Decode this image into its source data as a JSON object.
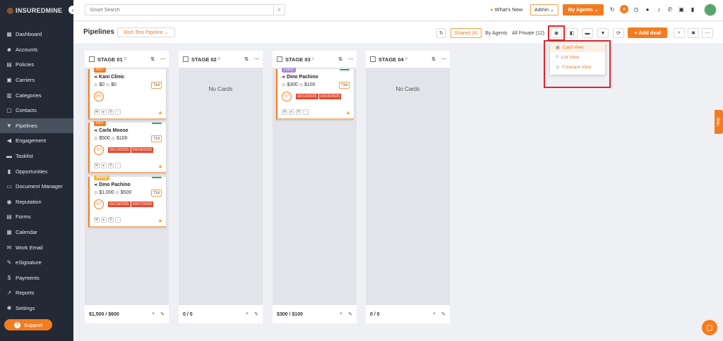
{
  "brand": {
    "name": "INSUREDMINE",
    "accent": "#f47c20"
  },
  "sidebar": {
    "items": [
      {
        "label": "Dashboard",
        "icon": "dashboard-icon",
        "glyph": "▦"
      },
      {
        "label": "Accounts",
        "icon": "accounts-icon",
        "glyph": "☻"
      },
      {
        "label": "Policies",
        "icon": "policies-icon",
        "glyph": "▤"
      },
      {
        "label": "Carriers",
        "icon": "carriers-icon",
        "glyph": "▣"
      },
      {
        "label": "Categories",
        "icon": "categories-icon",
        "glyph": "▥"
      },
      {
        "label": "Contacts",
        "icon": "contacts-icon",
        "glyph": "▢"
      },
      {
        "label": "Pipelines",
        "icon": "pipelines-icon",
        "glyph": "▼"
      },
      {
        "label": "Engagement",
        "icon": "engagement-icon",
        "glyph": "◀"
      },
      {
        "label": "Tasklist",
        "icon": "tasklist-icon",
        "glyph": "▬"
      },
      {
        "label": "Opportunities",
        "icon": "opportunities-icon",
        "glyph": "▮"
      },
      {
        "label": "Document Manager",
        "icon": "folder-icon",
        "glyph": "▭"
      },
      {
        "label": "Reputation",
        "icon": "reputation-icon",
        "glyph": "◉"
      },
      {
        "label": "Forms",
        "icon": "forms-icon",
        "glyph": "▤"
      },
      {
        "label": "Calendar",
        "icon": "calendar-icon",
        "glyph": "▦"
      },
      {
        "label": "Work Email",
        "icon": "email-icon",
        "glyph": "✉"
      },
      {
        "label": "eSignature",
        "icon": "esignature-icon",
        "glyph": "✎"
      },
      {
        "label": "Payments",
        "icon": "payments-icon",
        "glyph": "$"
      },
      {
        "label": "Reports",
        "icon": "reports-icon",
        "glyph": "↗"
      },
      {
        "label": "Settings",
        "icon": "gear-icon",
        "glyph": "✱"
      }
    ],
    "active_index": 6,
    "support_label": "Support"
  },
  "topbar": {
    "search_placeholder": "Smart Search",
    "whats_new": "What's New",
    "role_select": "Admin",
    "my_agents": "My Agents"
  },
  "subheader": {
    "title": "Pipelines",
    "pipeline_select": "Rish Test Pipeline",
    "shared": "Shared (4)",
    "by_agents": "By Agents",
    "all_private": "All Private (12)",
    "add_deal": "+ Add deal"
  },
  "view_menu": {
    "items": [
      "Card View",
      "List View",
      "Forecast View"
    ],
    "selected": "Card View"
  },
  "stages": [
    {
      "title": "STAGE 01",
      "count": "3",
      "footer": "$1,500 / $600",
      "cards": [
        {
          "tag": "HOT",
          "tag_color": "#f47c20",
          "name": "Kani Clinic",
          "amount1": "$0",
          "amount2": "$0",
          "days": "71d",
          "score": "0%",
          "dates": [],
          "green": false
        },
        {
          "tag": "HOT",
          "tag_color": "#f47c20",
          "name": "Carla Moose",
          "amount1": "$500",
          "amount2": "$100",
          "days": "71d",
          "score": "57",
          "dates": [
            "03/13/2025",
            "03/18/2025"
          ],
          "green": true
        },
        {
          "tag": "WARM",
          "tag_color": "#f5b34a",
          "name": "Dino Pachino",
          "amount1": "$1,000",
          "amount2": "$500",
          "days": "71d",
          "score": "57",
          "dates": [
            "03/13/2025",
            "03/27/2025"
          ],
          "green": true
        }
      ]
    },
    {
      "title": "STAGE 02",
      "count": "0",
      "footer": "0 / 0",
      "empty_text": "No Cards",
      "cards": []
    },
    {
      "title": "STAGE 03",
      "count": "1",
      "footer": "$300 / $100",
      "cards": [
        {
          "tag": "COLD",
          "tag_color": "#a98bd9",
          "name": "Dino Pachino",
          "amount1": "$300",
          "amount2": "$100",
          "days": "71d",
          "score": "57",
          "dates": [
            "03/13/2025",
            "03/18/2025"
          ],
          "green": true
        }
      ]
    },
    {
      "title": "STAGE 04",
      "count": "0",
      "footer": "0 / 0",
      "empty_text": "No Cards",
      "cards": []
    }
  ],
  "help_label": "Help"
}
